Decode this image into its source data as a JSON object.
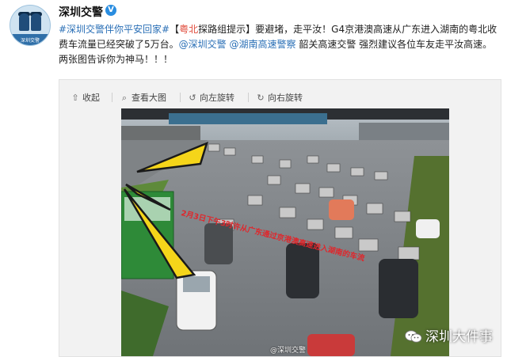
{
  "user": {
    "name": "深圳交警",
    "avatar_text": "深圳交警",
    "verified_symbol": "V"
  },
  "post": {
    "hashtag": "#深圳交警伴你平安回家#",
    "tag_open": "【",
    "tag_highlight": "粤北",
    "tag_rest": "探路组提示】",
    "body1": "要避堵，走平汝！G4京港澳高速从广东进入湖南的粤北收费车流量已经突破了5万台。",
    "mention1": "@深圳交警",
    "mention2": "@湖南高速警察",
    "body2": "韶关高速交警 强烈建议各位车友走平汝高速。两张图告诉你为神马！！！"
  },
  "toolbar": {
    "collapse": "收起",
    "view_large": "查看大图",
    "rotate_left": "向左旋转",
    "rotate_right": "向右旋转",
    "icons": {
      "collapse": "arrow-up-icon",
      "view_large": "magnifier-icon",
      "rotate_left": "rotate-left-icon",
      "rotate_right": "rotate-right-icon"
    }
  },
  "photo": {
    "caption": "2月3日下午3时许从广东通过京港澳高速进入湖南的车流",
    "watermark_small": "@深圳交警",
    "watermark_big": "深圳大件事"
  },
  "colors": {
    "link": "#2a6fb6",
    "highlight": "#e04a3a",
    "caption": "#e0262b",
    "arrow": "#f5d51a",
    "verified": "#2a8de0"
  }
}
